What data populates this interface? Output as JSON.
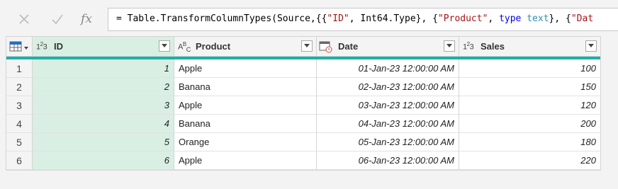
{
  "formula_bar": {
    "cancel_icon": "close-icon",
    "confirm_icon": "check-icon",
    "fx_label": "fx",
    "parts": [
      {
        "t": "= Table.TransformColumnTypes(Source,{{",
        "c": ""
      },
      {
        "t": "\"ID\"",
        "c": "tok-str"
      },
      {
        "t": ", Int64.Type}, {",
        "c": ""
      },
      {
        "t": "\"Product\"",
        "c": "tok-str"
      },
      {
        "t": ", ",
        "c": ""
      },
      {
        "t": "type",
        "c": "tok-kw"
      },
      {
        "t": " ",
        "c": ""
      },
      {
        "t": "text",
        "c": "tok-type"
      },
      {
        "t": "}, {",
        "c": ""
      },
      {
        "t": "\"Dat",
        "c": "tok-str"
      }
    ]
  },
  "table": {
    "columns": [
      {
        "name": "ID",
        "type_glyph": "1²3"
      },
      {
        "name": "Product",
        "type_glyph": "AᴮC"
      },
      {
        "name": "Date",
        "type_glyph": "calendar"
      },
      {
        "name": "Sales",
        "type_glyph": "1²3"
      }
    ],
    "rows": [
      {
        "n": "1",
        "id": "1",
        "product": "Apple",
        "date": "01-Jan-23 12:00:00 AM",
        "sales": "100"
      },
      {
        "n": "2",
        "id": "2",
        "product": "Banana",
        "date": "02-Jan-23 12:00:00 AM",
        "sales": "150"
      },
      {
        "n": "3",
        "id": "3",
        "product": "Apple",
        "date": "03-Jan-23 12:00:00 AM",
        "sales": "120"
      },
      {
        "n": "4",
        "id": "4",
        "product": "Banana",
        "date": "04-Jan-23 12:00:00 AM",
        "sales": "200"
      },
      {
        "n": "5",
        "id": "5",
        "product": "Orange",
        "date": "05-Jan-23 12:00:00 AM",
        "sales": "180"
      },
      {
        "n": "6",
        "id": "6",
        "product": "Apple",
        "date": "06-Jan-23 12:00:00 AM",
        "sales": "220"
      }
    ]
  },
  "colors": {
    "quality_bar": "#19b2a5",
    "selected_column": "#d9efe3",
    "string_token": "#a31515",
    "keyword_token": "#0000ff",
    "type_token": "#2b91af"
  }
}
